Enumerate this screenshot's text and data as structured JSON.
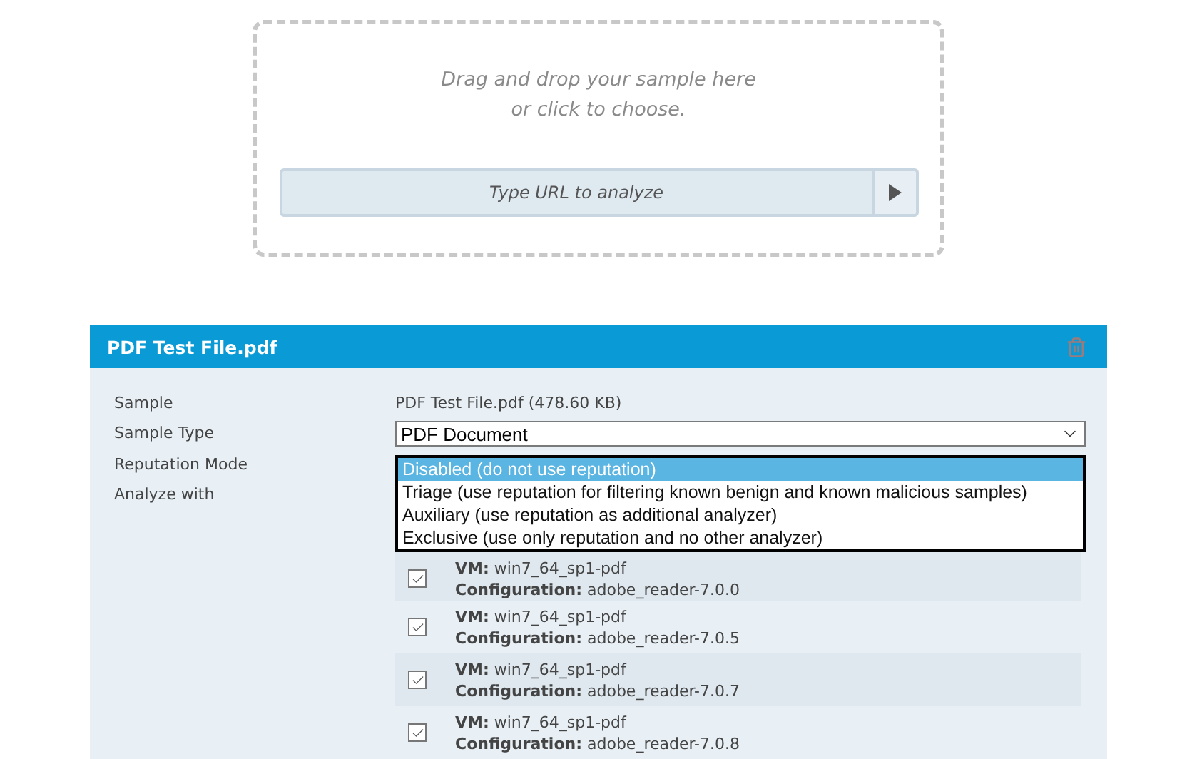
{
  "dropzone": {
    "prompt_line_1": "Drag and drop your sample here",
    "prompt_line_2": "or click to choose.",
    "url_field": {
      "placeholder": "Type URL to analyze"
    }
  },
  "sample_panel": {
    "title": "PDF Test File.pdf",
    "fields": [
      {
        "label": "Sample",
        "kind": "text",
        "value": "PDF Test File.pdf (478.60 KB)"
      },
      {
        "label": "Sample Type",
        "kind": "select",
        "value": "PDF Document"
      },
      {
        "label": "Reputation Mode",
        "kind": "open_list",
        "options": [
          {
            "label": "Disabled (do not use reputation)",
            "selected": true
          },
          {
            "label": "Triage (use reputation for filtering known benign and known malicious samples)",
            "selected": false
          },
          {
            "label": "Auxiliary (use reputation as additional analyzer)",
            "selected": false
          },
          {
            "label": "Exclusive (use only reputation and no other analyzer)",
            "selected": false
          }
        ]
      },
      {
        "label": "Analyze with",
        "kind": "vm_list",
        "items": [
          {
            "vm_label": "VM:",
            "vm": "win7_64_sp1-pdf",
            "config_label": "Configuration:",
            "config": "adobe_reader-7.0.0",
            "checked": true
          },
          {
            "vm_label": "VM:",
            "vm": "win7_64_sp1-pdf",
            "config_label": "Configuration:",
            "config": "adobe_reader-7.0.5",
            "checked": true
          },
          {
            "vm_label": "VM:",
            "vm": "win7_64_sp1-pdf",
            "config_label": "Configuration:",
            "config": "adobe_reader-7.0.7",
            "checked": true
          },
          {
            "vm_label": "VM:",
            "vm": "win7_64_sp1-pdf",
            "config_label": "Configuration:",
            "config": "adobe_reader-7.0.8",
            "checked": true
          }
        ]
      }
    ]
  }
}
